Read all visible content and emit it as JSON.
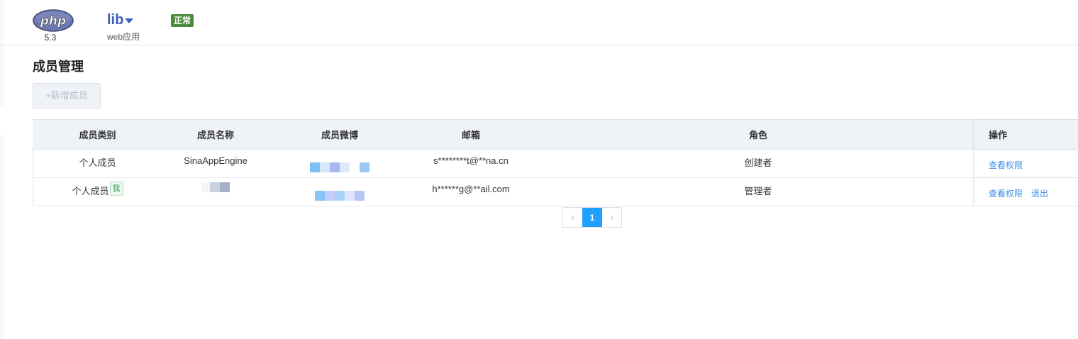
{
  "header": {
    "runtime_version": "5.3",
    "app_name": "lib",
    "app_type": "web应用",
    "status": "正常",
    "colors": {
      "status_badge": "#4a8b3b",
      "app_name": "#3a5fb8"
    }
  },
  "page": {
    "title": "成员管理",
    "add_button": "+新增成员"
  },
  "table": {
    "headers": {
      "type": "成员类别",
      "name": "成员名称",
      "weibo": "成员微博",
      "email": "邮箱",
      "role": "角色",
      "action": "操作"
    },
    "rows": [
      {
        "type": "个人成员",
        "me_tag": "",
        "name": "SinaAppEngine",
        "email": "s********t@**na.cn",
        "role": "创建者",
        "action_view": "查看权限",
        "action_quit": ""
      },
      {
        "type": "个人成员",
        "me_tag": "我",
        "name": "",
        "email": "h******g@**ail.com",
        "role": "管理者",
        "action_view": "查看权限",
        "action_quit": "退出"
      }
    ]
  },
  "pagination": {
    "current_page": "1",
    "active_color": "#20a0ff"
  }
}
